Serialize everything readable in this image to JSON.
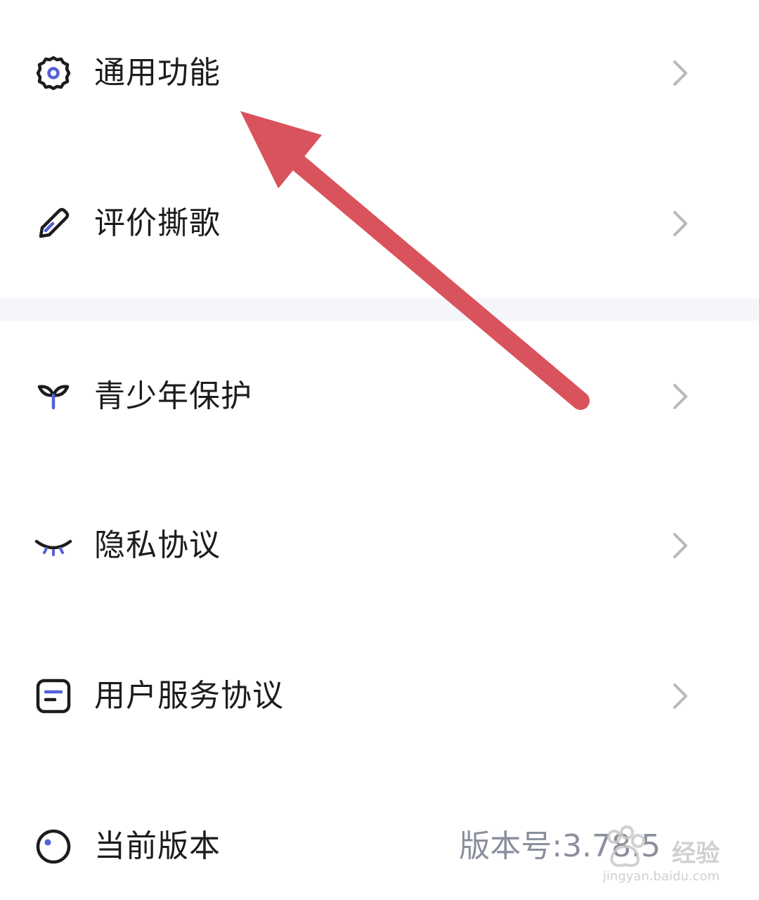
{
  "menu": {
    "items": [
      {
        "label": "通用功能",
        "icon": "gear-icon"
      },
      {
        "label": "评价撕歌",
        "icon": "pencil-icon"
      },
      {
        "label": "青少年保护",
        "icon": "sprout-icon"
      },
      {
        "label": "隐私协议",
        "icon": "closed-eye-icon"
      },
      {
        "label": "用户服务协议",
        "icon": "document-icon"
      }
    ],
    "version": {
      "label": "当前版本",
      "icon": "circle-dot-icon",
      "value": "版本号:3.78.5"
    }
  },
  "watermark": {
    "text": "经验",
    "sub": "jingyan.baidu.com"
  },
  "colors": {
    "accent": "#5561d8",
    "arrow": "#d9535c",
    "chevron": "#b8b8be",
    "band": "#f5f6fa"
  }
}
